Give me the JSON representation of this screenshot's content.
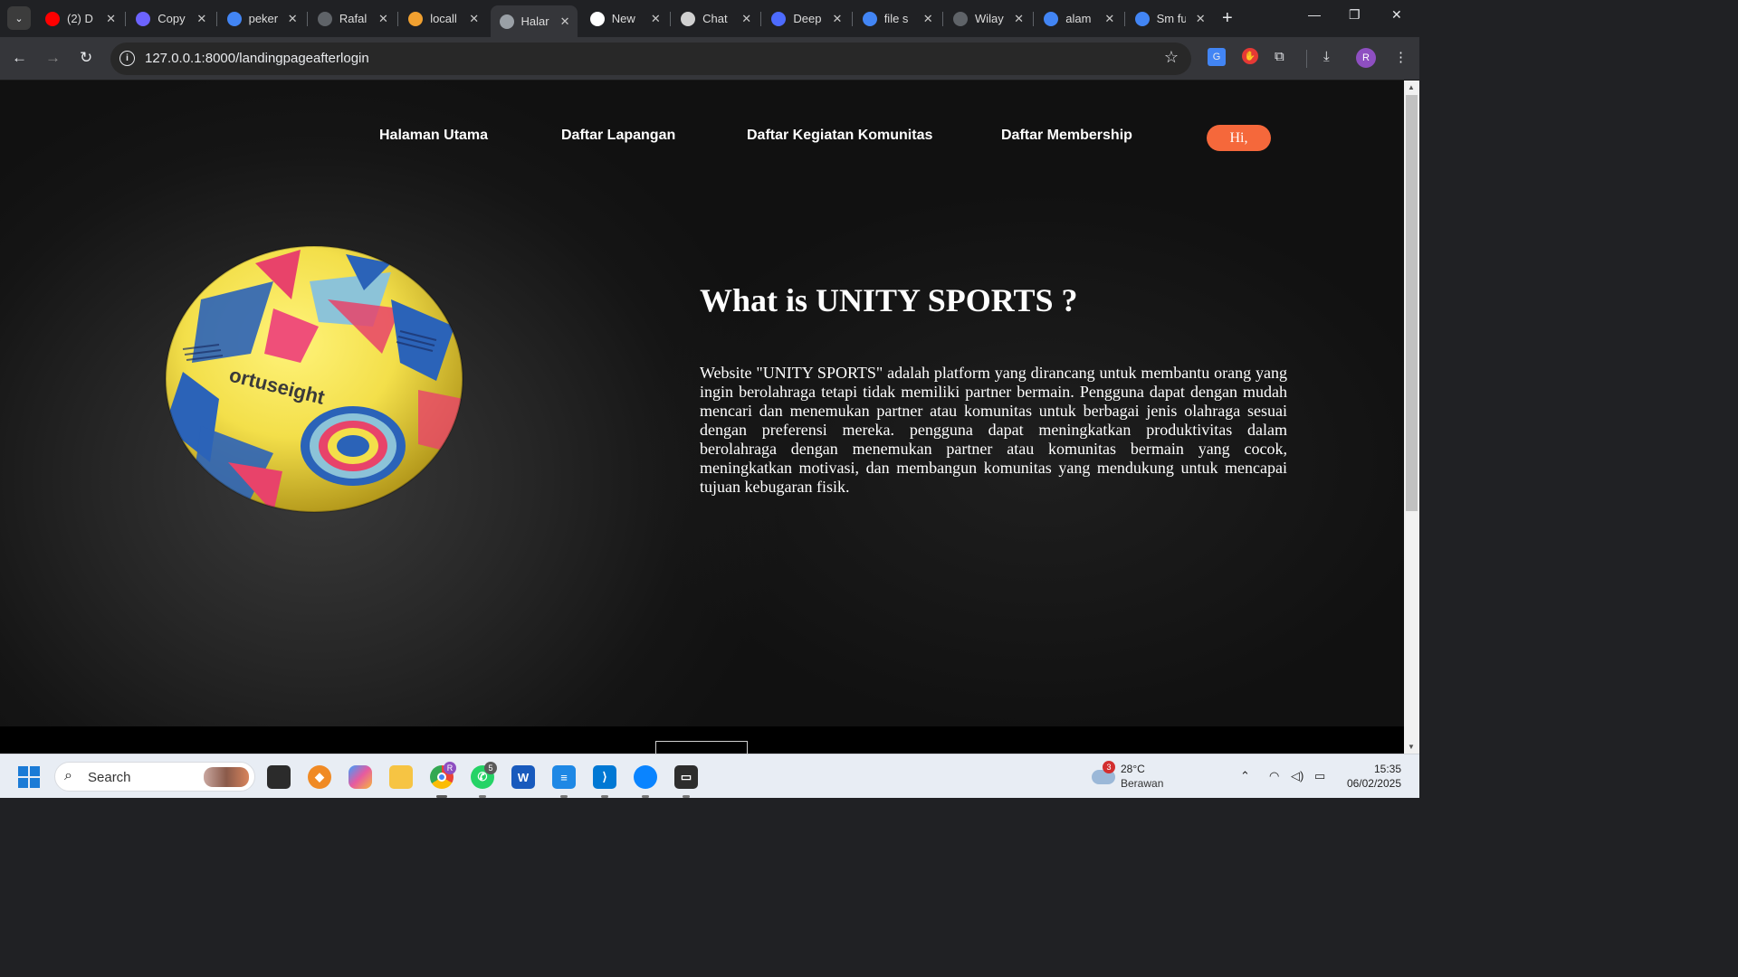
{
  "browser": {
    "tabs": [
      {
        "title": "(2) D",
        "icon": "youtube-icon",
        "color": "#ff0000"
      },
      {
        "title": "Copy",
        "icon": "copy-app-icon",
        "color": "#6c63ff"
      },
      {
        "title": "peker",
        "icon": "google-icon",
        "color": "#4285f4"
      },
      {
        "title": "Rafal",
        "icon": "loading-icon",
        "color": "#5f6368"
      },
      {
        "title": "locall",
        "icon": "xampp-icon",
        "color": "#f0a030"
      },
      {
        "title": "Halar",
        "icon": "globe-icon",
        "color": "#9aa0a6"
      },
      {
        "title": "New",
        "icon": "vercel-icon",
        "color": "#ffffff"
      },
      {
        "title": "Chat",
        "icon": "chatgpt-icon",
        "color": "#d0d0d0"
      },
      {
        "title": "Deep",
        "icon": "deepseek-icon",
        "color": "#4d6bfe"
      },
      {
        "title": "file s",
        "icon": "google-icon",
        "color": "#4285f4"
      },
      {
        "title": "Wilay",
        "icon": "loading-icon",
        "color": "#5f6368"
      },
      {
        "title": "alam",
        "icon": "google-icon",
        "color": "#4285f4"
      },
      {
        "title": "Sm fu",
        "icon": "google-icon",
        "color": "#4285f4"
      }
    ],
    "active_tab": 5,
    "url": "127.0.0.1:8000/landingpageafterlogin",
    "profile_initial": "R"
  },
  "site": {
    "nav": {
      "home": "Halaman Utama",
      "fields": "Daftar Lapangan",
      "community": "Daftar Kegiatan Komunitas",
      "membership": "Daftar Membership",
      "greeting": "Hi,"
    },
    "hero": {
      "ball_brand": "ortuseight",
      "title": "What is UNITY SPORTS ?",
      "description": "Website \"UNITY SPORTS\" adalah platform yang dirancang untuk membantu orang yang ingin berolahraga tetapi tidak memiliki partner bermain. Pengguna dapat dengan mudah mencari dan menemukan partner atau komunitas untuk berbagai jenis olahraga sesuai dengan preferensi mereka. pengguna dapat meningkatkan produktivitas dalam berolahraga dengan menemukan partner atau komunitas bermain yang cocok, meningkatkan motivasi, dan membangun komunitas yang mendukung untuk mencapai tujuan kebugaran fisik."
    },
    "accent_color": "#f5683b"
  },
  "taskbar": {
    "search_placeholder": "Search",
    "chrome_badge": "R",
    "whatsapp_badge": "5",
    "weather_badge": "3",
    "temperature": "28°C",
    "condition": "Berawan",
    "time": "15:35",
    "date": "06/02/2025"
  }
}
